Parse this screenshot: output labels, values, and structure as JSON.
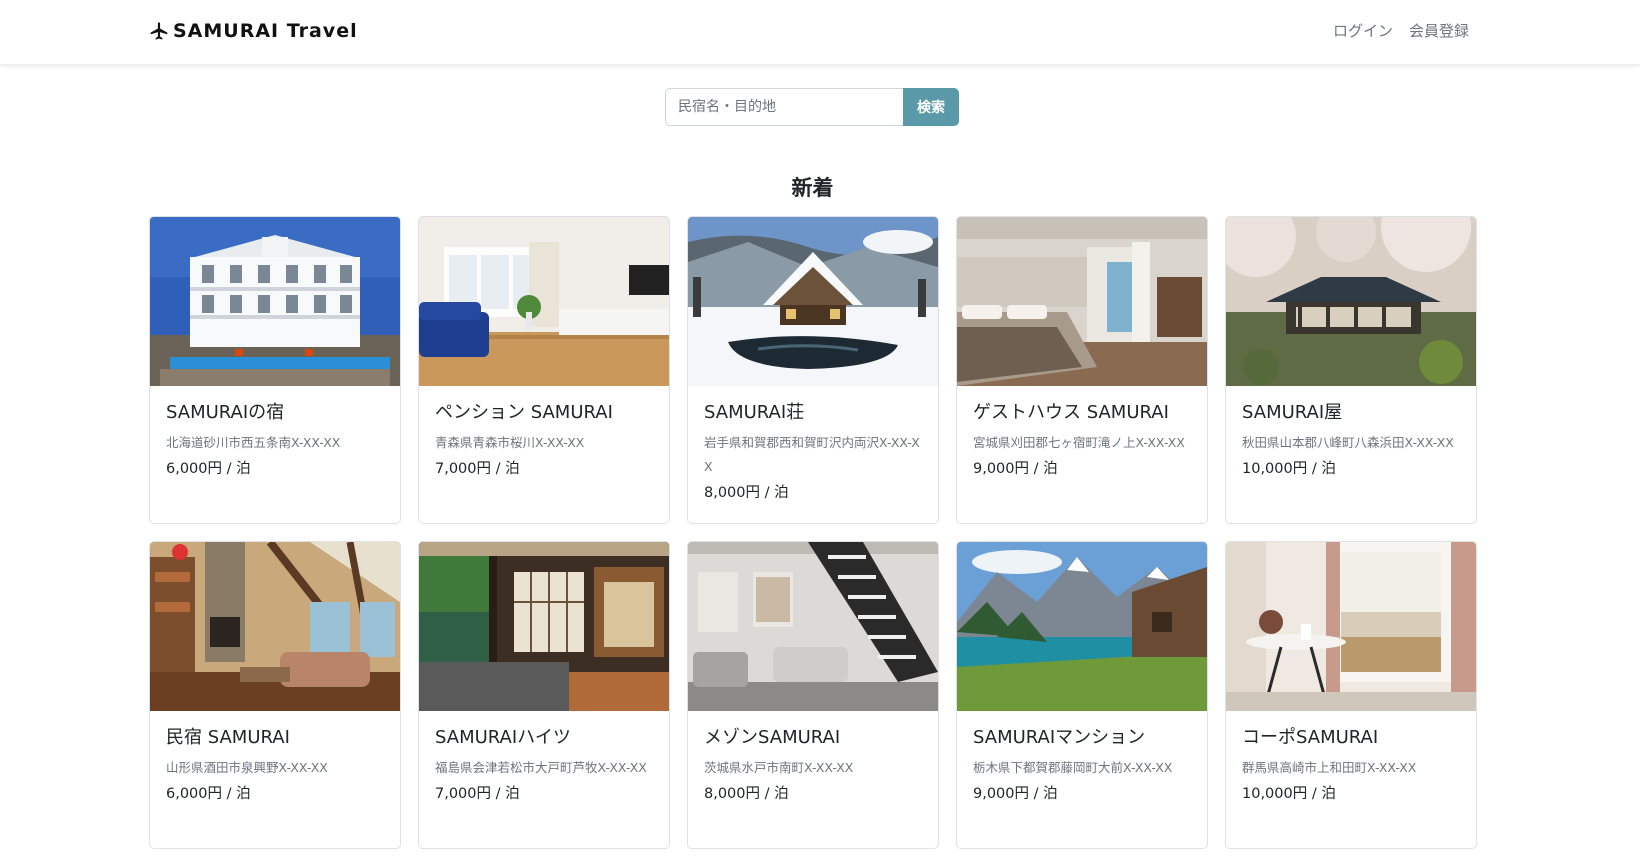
{
  "navbar": {
    "brand": "SAMURAI Travel",
    "brand_icon": "airplane-icon",
    "login": "ログイン",
    "register": "会員登録"
  },
  "search": {
    "placeholder": "民宿名・目的地",
    "value": "",
    "button_label": "検索"
  },
  "section_title": "新着",
  "inns": [
    {
      "name": "SAMURAIの宿",
      "address": "北海道砂川市西五条南X-XX-XX",
      "price": "6,000円 / 泊",
      "image": "mansion-with-pool"
    },
    {
      "name": "ペンション SAMURAI",
      "address": "青森県青森市桜川X-XX-XX",
      "price": "7,000円 / 泊",
      "image": "living-room-blue-sofa"
    },
    {
      "name": "SAMURAI荘",
      "address": "岩手県和賀郡西和賀町沢内両沢X-XX-XX",
      "price": "8,000円 / 泊",
      "image": "snowy-thatched-house"
    },
    {
      "name": "ゲストハウス SAMURAI",
      "address": "宮城県刈田郡七ヶ宿町滝ノ上X-XX-XX",
      "price": "9,000円 / 泊",
      "image": "hotel-bedroom"
    },
    {
      "name": "SAMURAI屋",
      "address": "秋田県山本郡八峰町八森浜田X-XX-XX",
      "price": "10,000円 / 泊",
      "image": "temple-cherry-blossom"
    },
    {
      "name": "民宿 SAMURAI",
      "address": "山形県酒田市泉興野X-XX-XX",
      "price": "6,000円 / 泊",
      "image": "cabin-living-room"
    },
    {
      "name": "SAMURAIハイツ",
      "address": "福島県会津若松市大戸町芦牧X-XX-XX",
      "price": "7,000円 / 泊",
      "image": "japanese-house-garden"
    },
    {
      "name": "メゾンSAMURAI",
      "address": "茨城県水戸市南町X-XX-XX",
      "price": "8,000円 / 泊",
      "image": "loft-staircase"
    },
    {
      "name": "SAMURAIマンション",
      "address": "栃木県下都賀郡藤岡町大前X-XX-XX",
      "price": "9,000円 / 泊",
      "image": "alpine-lake"
    },
    {
      "name": "コーポSAMURAI",
      "address": "群馬県高崎市上和田町X-XX-XX",
      "price": "10,000円 / 泊",
      "image": "room-with-view"
    }
  ]
}
